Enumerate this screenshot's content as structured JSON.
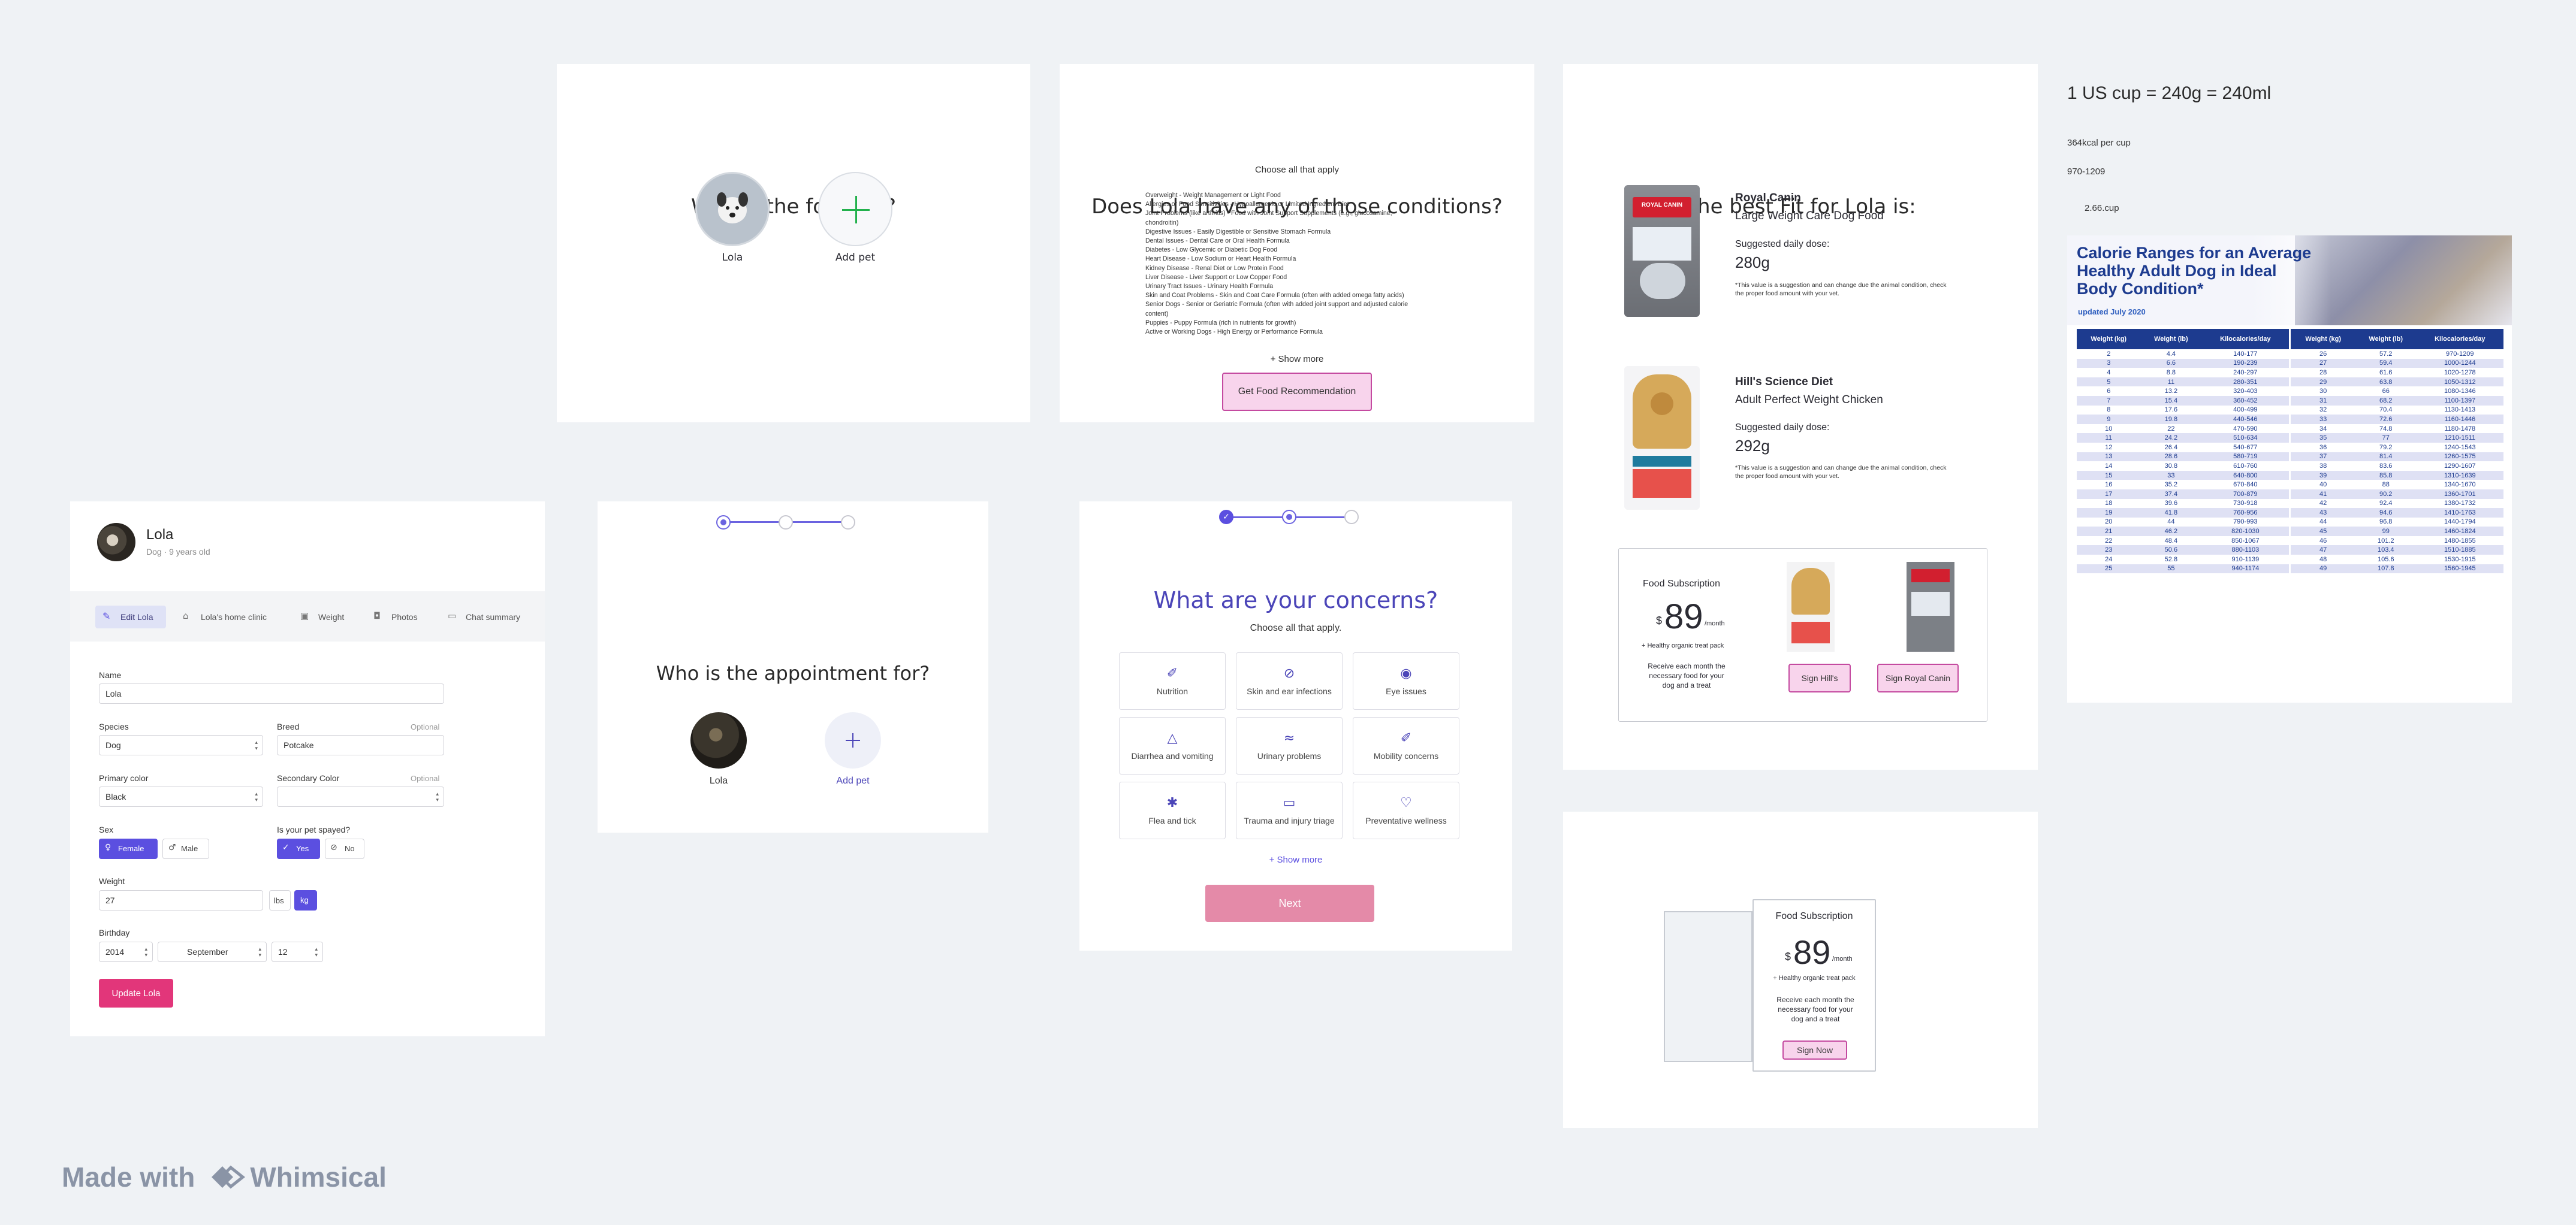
{
  "frame_food_for": {
    "title": "Who is the food for?",
    "pet_name": "Lola",
    "add_pet": "Add pet"
  },
  "frame_conditions": {
    "title": "Does Lola have any of those conditions?",
    "subtitle": "Choose all that apply",
    "conditions": [
      "Overweight - Weight Management or Light Food",
      "Allergies or Food Sensitivities - Hypoallergenic or Limited Ingredient Diet",
      "Joint Problems (like arthritis) - Food with Joint Support Supplements (e.g., glucosamine,",
      "chondroitin)",
      "Digestive Issues - Easily Digestible or Sensitive Stomach Formula",
      "Dental Issues - Dental Care or Oral Health Formula",
      "Diabetes - Low Glycemic or Diabetic Dog Food",
      "Heart Disease - Low Sodium or Heart Health Formula",
      "Kidney Disease - Renal Diet or Low Protein Food",
      "Liver Disease - Liver Support or Low Copper Food",
      "Urinary Tract Issues - Urinary Health Formula",
      "Skin and Coat Problems - Skin and Coat Care Formula (often with added omega fatty acids)",
      "Senior Dogs - Senior or Geriatric Formula (often with added joint support and adjusted calorie",
      "content)",
      "Puppies - Puppy Formula (rich in nutrients for growth)",
      "Active or Working Dogs - High Energy or Performance Formula"
    ],
    "show_more": "+ Show more",
    "button": "Get Food Recommendation"
  },
  "frame_best_fit": {
    "title": "The best Fit for Lola is:",
    "products": [
      {
        "brand": "Royal Canin",
        "name": "Large Weight Care Dog Food",
        "dose_label": "Suggested daily dose:",
        "dose": "280g",
        "note": "*This value is a suggestion and can change due the animal condition, check the proper food amount with your vet."
      },
      {
        "brand": "Hill's Science Diet",
        "name": "Adult Perfect Weight Chicken",
        "dose_label": "Suggested daily dose:",
        "dose": "292g",
        "note": "*This value is a suggestion and can change due the animal condition, check the proper food amount with your vet."
      }
    ],
    "subscription": {
      "title": "Food Subscription",
      "currency": "$",
      "price": "89",
      "period": "/month",
      "perk": "+ Healthy organic treat pack",
      "desc": "Receive each month the necessary food for your dog and a treat",
      "btn_hills": "Sign Hill's",
      "btn_royal": "Sign Royal Canin"
    }
  },
  "frame_subscription": {
    "title": "Food Subscription",
    "currency": "$",
    "price": "89",
    "period": "/month",
    "perk": "+ Healthy organic treat pack",
    "desc": "Receive each month the necessary food for your dog and a treat",
    "button": "Sign Now"
  },
  "notes": {
    "cup": "1 US cup = 240g = 240ml",
    "kcal": "364kcal per cup",
    "range": "970-1209",
    "cups": "2.66.cup"
  },
  "calorie_chart": {
    "title": "Calorie Ranges for an Average Healthy Adult Dog in Ideal Body Condition*",
    "updated": "updated July 2020",
    "headers": [
      "Weight (kg)",
      "Weight (lb)",
      "Kilocalories/day",
      "Weight (kg)",
      "Weight (lb)",
      "Kilocalories/day"
    ],
    "rows": [
      [
        "2",
        "4.4",
        "140-177",
        "26",
        "57.2",
        "970-1209"
      ],
      [
        "3",
        "6.6",
        "190-239",
        "27",
        "59.4",
        "1000-1244"
      ],
      [
        "4",
        "8.8",
        "240-297",
        "28",
        "61.6",
        "1020-1278"
      ],
      [
        "5",
        "11",
        "280-351",
        "29",
        "63.8",
        "1050-1312"
      ],
      [
        "6",
        "13.2",
        "320-403",
        "30",
        "66",
        "1080-1346"
      ],
      [
        "7",
        "15.4",
        "360-452",
        "31",
        "68.2",
        "1100-1397"
      ],
      [
        "8",
        "17.6",
        "400-499",
        "32",
        "70.4",
        "1130-1413"
      ],
      [
        "9",
        "19.8",
        "440-546",
        "33",
        "72.6",
        "1160-1446"
      ],
      [
        "10",
        "22",
        "470-590",
        "34",
        "74.8",
        "1180-1478"
      ],
      [
        "11",
        "24.2",
        "510-634",
        "35",
        "77",
        "1210-1511"
      ],
      [
        "12",
        "26.4",
        "540-677",
        "36",
        "79.2",
        "1240-1543"
      ],
      [
        "13",
        "28.6",
        "580-719",
        "37",
        "81.4",
        "1260-1575"
      ],
      [
        "14",
        "30.8",
        "610-760",
        "38",
        "83.6",
        "1290-1607"
      ],
      [
        "15",
        "33",
        "640-800",
        "39",
        "85.8",
        "1310-1639"
      ],
      [
        "16",
        "35.2",
        "670-840",
        "40",
        "88",
        "1340-1670"
      ],
      [
        "17",
        "37.4",
        "700-879",
        "41",
        "90.2",
        "1360-1701"
      ],
      [
        "18",
        "39.6",
        "730-918",
        "42",
        "92.4",
        "1380-1732"
      ],
      [
        "19",
        "41.8",
        "760-956",
        "43",
        "94.6",
        "1410-1763"
      ],
      [
        "20",
        "44",
        "790-993",
        "44",
        "96.8",
        "1440-1794"
      ],
      [
        "21",
        "46.2",
        "820-1030",
        "45",
        "99",
        "1460-1824"
      ],
      [
        "22",
        "48.4",
        "850-1067",
        "46",
        "101.2",
        "1480-1855"
      ],
      [
        "23",
        "50.6",
        "880-1103",
        "47",
        "103.4",
        "1510-1885"
      ],
      [
        "24",
        "52.8",
        "910-1139",
        "48",
        "105.6",
        "1530-1915"
      ],
      [
        "25",
        "55",
        "940-1174",
        "49",
        "107.8",
        "1560-1945"
      ]
    ]
  },
  "profile": {
    "name": "Lola",
    "subtitle": "Dog · 9 years old",
    "tabs": [
      "Edit Lola",
      "Lola's home clinic",
      "Weight",
      "Photos",
      "Chat summary"
    ],
    "labels": {
      "name": "Name",
      "species": "Species",
      "breed": "Breed",
      "optional": "Optional",
      "primary_color": "Primary color",
      "secondary_color": "Secondary Color",
      "sex": "Sex",
      "spayed": "Is your pet spayed?",
      "weight": "Weight",
      "birthday": "Birthday"
    },
    "values": {
      "name": "Lola",
      "species": "Dog",
      "breed": "Potcake",
      "primary_color": "Black",
      "secondary_color": "",
      "weight": "27",
      "year": "2014",
      "month": "September",
      "day": "12"
    },
    "sex_options": [
      "Female",
      "Male"
    ],
    "spayed_options": [
      "Yes",
      "No"
    ],
    "units": [
      "lbs",
      "kg"
    ],
    "button": "Update Lola"
  },
  "appointment": {
    "title": "Who is the appointment for?",
    "pet_name": "Lola",
    "add_pet": "Add pet"
  },
  "concerns": {
    "title": "What are your concerns?",
    "subtitle": "Choose all that apply.",
    "items": [
      "Nutrition",
      "Skin and ear infections",
      "Eye issues",
      "Diarrhea and vomiting",
      "Urinary problems",
      "Mobility concerns",
      "Flea and tick",
      "Trauma and injury triage",
      "Preventative wellness"
    ],
    "icons": [
      "syringe-icon",
      "bandage-icon",
      "eye-icon",
      "drop-icon",
      "urinary-icon",
      "walk-icon",
      "bug-icon",
      "first-aid-icon",
      "heart-pulse-icon"
    ],
    "show_more": "+ Show more",
    "next": "Next"
  },
  "watermark": {
    "made_with": "Made with",
    "brand": "Whimsical"
  },
  "colors": {
    "accent": "#5b4fe0",
    "pink_button": "#e2367a",
    "next_button": "#e48aa8",
    "chart_blue": "#1d3b8f"
  }
}
